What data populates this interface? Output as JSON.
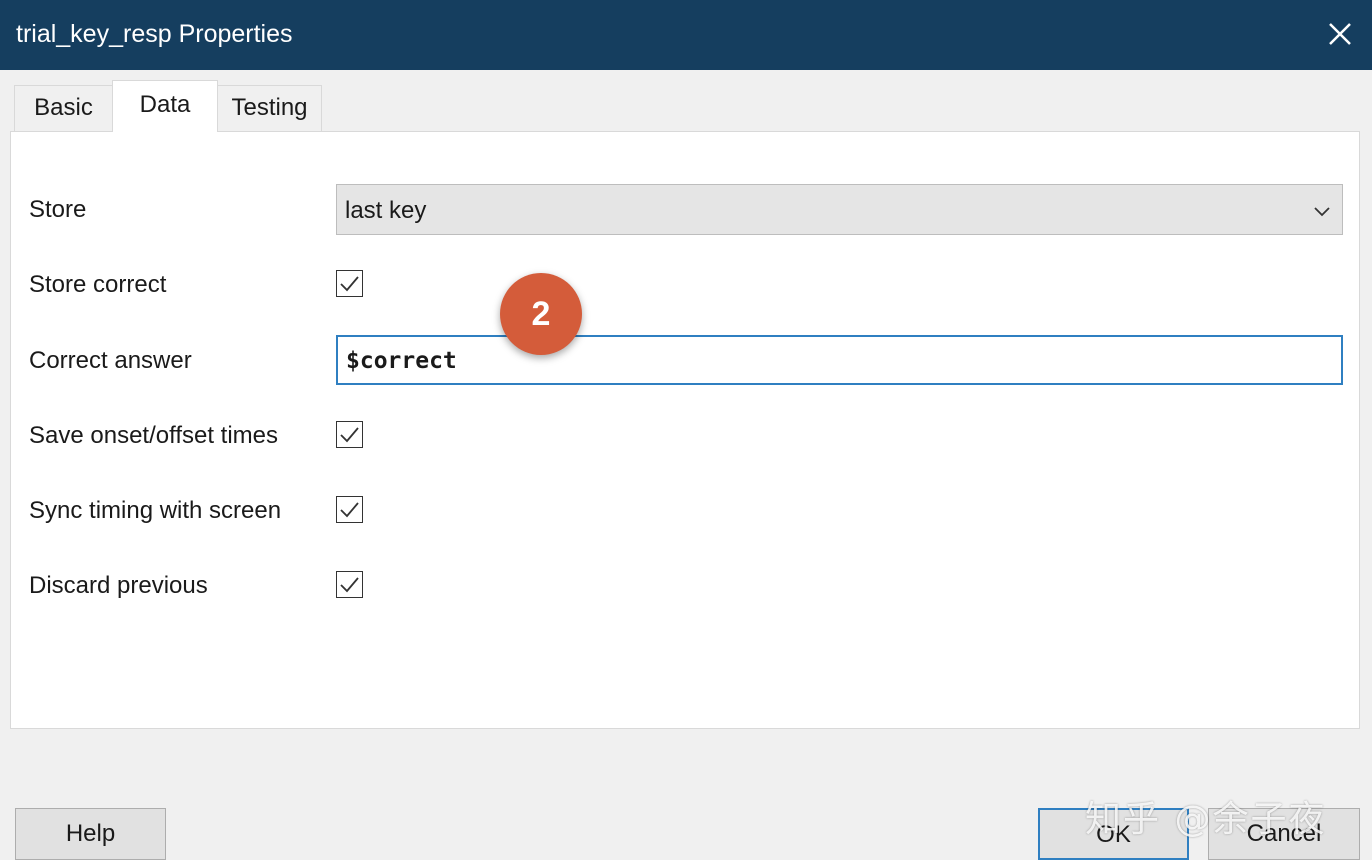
{
  "window": {
    "title": "trial_key_resp Properties",
    "close_icon": "close-icon"
  },
  "tabs": [
    {
      "label": "Basic",
      "active": false
    },
    {
      "label": "Data",
      "active": true
    },
    {
      "label": "Testing",
      "active": false
    }
  ],
  "form": {
    "store": {
      "label": "Store",
      "value": "last key"
    },
    "store_correct": {
      "label": "Store correct",
      "checked": true
    },
    "correct_answer": {
      "label": "Correct answer",
      "value": "$correct"
    },
    "save_onset_offset": {
      "label": "Save onset/offset times",
      "checked": true
    },
    "sync_timing": {
      "label": "Sync timing with screen",
      "checked": true
    },
    "discard_previous": {
      "label": "Discard previous",
      "checked": true
    }
  },
  "annotation": {
    "step_number": "2",
    "color": "#d45c3a"
  },
  "buttons": {
    "help": "Help",
    "ok": "OK",
    "cancel": "Cancel"
  },
  "watermark": "知乎 @余子夜",
  "colors": {
    "titlebar": "#153e5f",
    "focus_border": "#2f7fc1"
  }
}
